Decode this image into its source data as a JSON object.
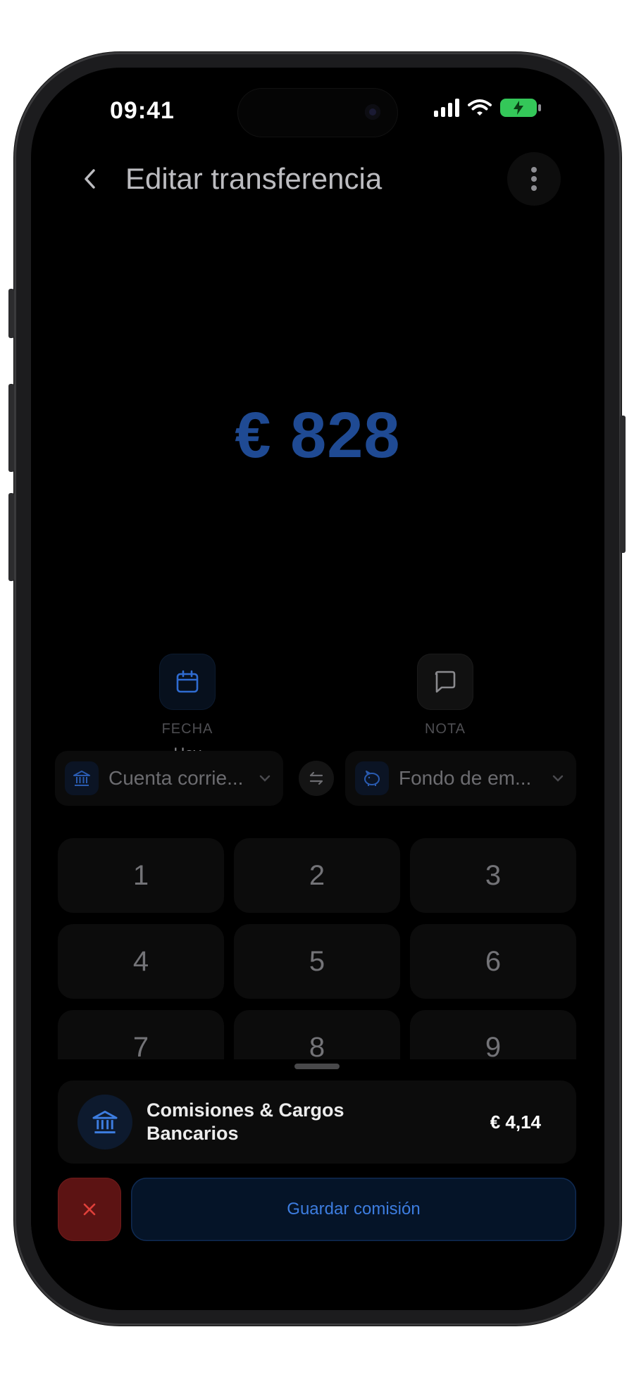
{
  "status_bar": {
    "time": "09:41"
  },
  "header": {
    "title": "Editar transferencia"
  },
  "amount": {
    "display": "€ 828"
  },
  "actions": [
    {
      "label": "FECHA",
      "value": "Hoy",
      "icon": "calendar-icon"
    },
    {
      "label": "NOTA",
      "value": "",
      "icon": "message-icon"
    }
  ],
  "accounts": {
    "from": {
      "label": "Cuenta corrie...",
      "icon": "bank-icon"
    },
    "to": {
      "label": "Fondo de em...",
      "icon": "piggy-bank-icon"
    }
  },
  "keypad": {
    "keys": [
      "1",
      "2",
      "3",
      "4",
      "5",
      "6",
      "7",
      "8",
      "9"
    ]
  },
  "fee": {
    "category": "Comisiones & Cargos Bancarios",
    "amount": "€ 4,14",
    "icon": "bank-icon"
  },
  "buttons": {
    "cancel_icon": "close-icon",
    "save_label": "Guardar comisión"
  },
  "colors": {
    "accent": "#3d7de0",
    "amount": "#1f4a93",
    "cancel": "#5c1313",
    "battery": "#34c759"
  }
}
